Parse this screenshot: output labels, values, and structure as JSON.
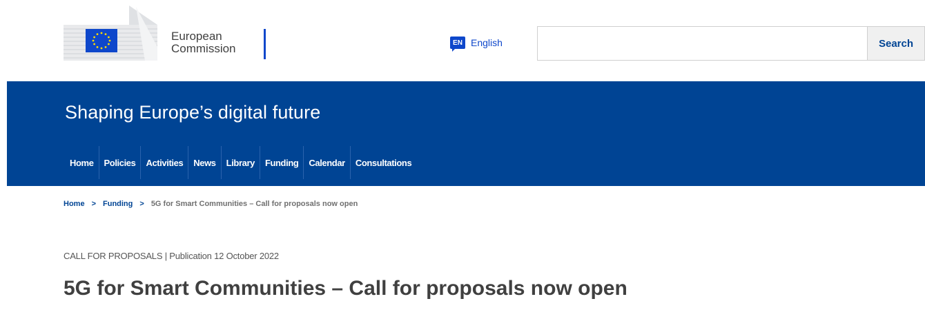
{
  "header": {
    "logo": {
      "line1": "European",
      "line2": "Commission"
    },
    "language": {
      "badge": "EN",
      "label": "English"
    },
    "search": {
      "value": "",
      "button_label": "Search"
    }
  },
  "banner": {
    "site_title": "Shaping Europe’s digital future",
    "nav": [
      {
        "label": "Home"
      },
      {
        "label": "Policies"
      },
      {
        "label": "Activities"
      },
      {
        "label": "News"
      },
      {
        "label": "Library"
      },
      {
        "label": "Funding"
      },
      {
        "label": "Calendar"
      },
      {
        "label": "Consultations"
      }
    ]
  },
  "breadcrumb": {
    "items": [
      "Home",
      "Funding"
    ],
    "separator": ">",
    "current": "5G for Smart Communities – Call for proposals now open"
  },
  "article": {
    "meta": "CALL FOR PROPOSALS | Publication 12 October 2022",
    "title": "5G for Smart Communities – Call for proposals now open"
  },
  "colors": {
    "brand_blue": "#004494",
    "link_blue": "#0e47cb",
    "eu_yellow": "#ffdd00"
  }
}
